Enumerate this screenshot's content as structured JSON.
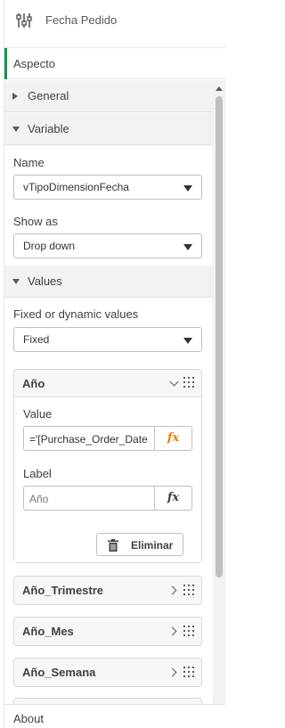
{
  "header": {
    "title": "Fecha Pedido",
    "icon": "sliders-icon"
  },
  "tab": {
    "label": "Aspecto",
    "accent": "#009845"
  },
  "sections": {
    "general": "General",
    "variable": "Variable",
    "values": "Values"
  },
  "variable": {
    "name_label": "Name",
    "name_value": "vTipoDimensionFecha",
    "showas_label": "Show as",
    "showas_value": "Drop down"
  },
  "values": {
    "fixed_label": "Fixed or dynamic values",
    "fixed_value": "Fixed",
    "items": [
      {
        "title": "Año",
        "expanded": true,
        "value_label": "Value",
        "value": "='[Purchase_Order_Date",
        "label_label": "Label",
        "label_placeholder": "Año",
        "delete_label": "Eliminar"
      },
      {
        "title": "Año_Trimestre",
        "expanded": false
      },
      {
        "title": "Año_Mes",
        "expanded": false
      },
      {
        "title": "Año_Semana",
        "expanded": false
      }
    ]
  },
  "fx_label": "fx",
  "fx_color": "#e67e00",
  "footer": {
    "about": "About"
  }
}
